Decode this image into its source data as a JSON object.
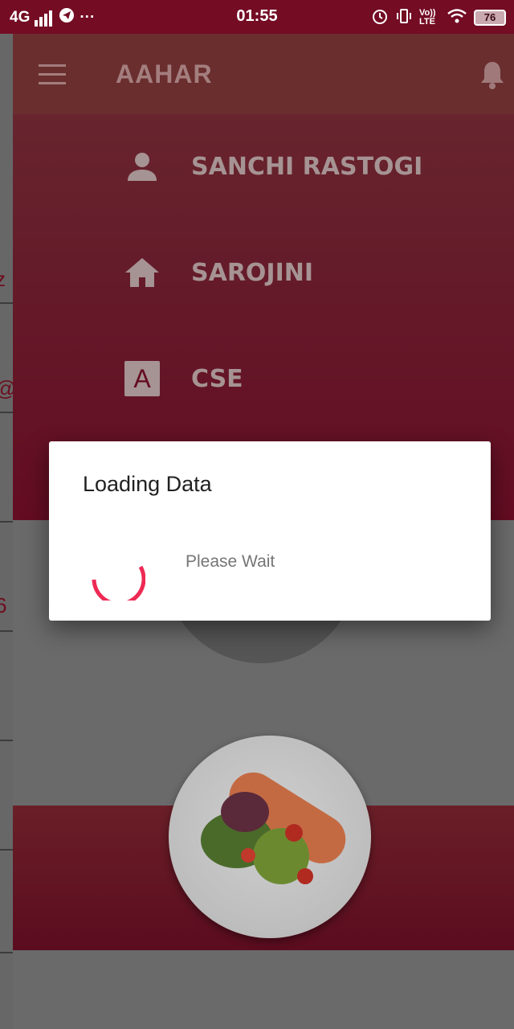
{
  "status_bar": {
    "network": "4G",
    "more": "···",
    "time": "01:55",
    "volte": "Vo)) LTE",
    "battery": "76"
  },
  "toolbar": {
    "title": "AAHAR"
  },
  "drawer": {
    "items": [
      {
        "icon": "person-icon",
        "label": "SANCHI RASTOGI"
      },
      {
        "icon": "home-icon",
        "label": "SAROJINI"
      },
      {
        "icon": "letter-a-icon",
        "label": "CSE"
      }
    ]
  },
  "background_page": {
    "fragments": [
      "z",
      "@",
      "6"
    ]
  },
  "dialog": {
    "title": "Loading Data",
    "message": "Please Wait"
  },
  "colors": {
    "status_bar": "#740c24",
    "drawer_header": "#640c22",
    "spinner": "#ee2a54"
  }
}
